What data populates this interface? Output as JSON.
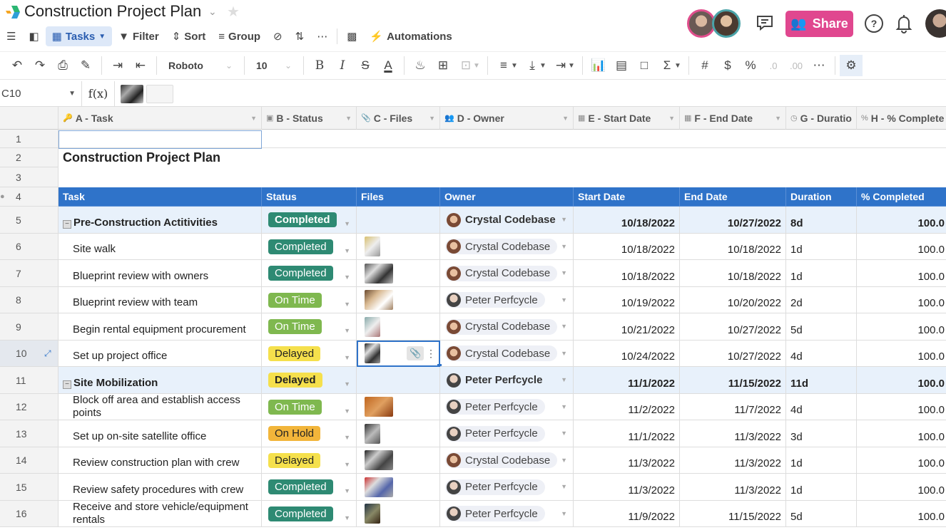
{
  "app": {
    "title": "Construction Project Plan",
    "share_label": "Share",
    "colors": {
      "accent": "#2f73c9",
      "share": "#e0478f",
      "completed": "#2e8a73",
      "on_time": "#7fb84f",
      "delayed": "#f5e04c",
      "on_hold": "#f2b53a"
    }
  },
  "viewbar": {
    "view_name": "Tasks",
    "filter": "Filter",
    "sort": "Sort",
    "group": "Group",
    "automations": "Automations"
  },
  "format": {
    "font": "Roboto",
    "size": "10"
  },
  "formula": {
    "cell_ref": "C10",
    "fx": "f(x)"
  },
  "columns": [
    {
      "label": "A - Task",
      "icon": "key-icon"
    },
    {
      "label": "B - Status",
      "icon": "dropdown-icon"
    },
    {
      "label": "C - Files",
      "icon": "attachment-icon"
    },
    {
      "label": "D - Owner",
      "icon": "people-icon"
    },
    {
      "label": "E - Start Date",
      "icon": "calendar-icon"
    },
    {
      "label": "F - End Date",
      "icon": "calendar-icon"
    },
    {
      "label": "G - Duratio",
      "icon": "clock-icon"
    },
    {
      "label": "H - % Complete",
      "icon": "percent-icon"
    }
  ],
  "sheet_title": "Construction Project Plan",
  "table_header": [
    "Task",
    "Status",
    "Files",
    "Owner",
    "Start Date",
    "End Date",
    "Duration",
    "% Completed"
  ],
  "rows": [
    {
      "num": "5",
      "group": true,
      "task": "Pre-Construction Actitivities",
      "status": "Completed",
      "status_key": "completed",
      "files": 0,
      "owner": "Crystal Codebase",
      "owner_key": "crystal",
      "start": "10/18/2022",
      "end": "10/27/2022",
      "duration": "8d",
      "pct": "100.0"
    },
    {
      "num": "6",
      "task": "Site walk",
      "status": "Completed",
      "status_key": "completed",
      "files": 1,
      "owner": "Crystal Codebase",
      "owner_key": "crystal",
      "start": "10/18/2022",
      "end": "10/18/2022",
      "duration": "1d",
      "pct": "100.0"
    },
    {
      "num": "7",
      "task": "Blueprint review with owners",
      "status": "Completed",
      "status_key": "completed",
      "files": 1,
      "owner": "Crystal Codebase",
      "owner_key": "crystal",
      "start": "10/18/2022",
      "end": "10/18/2022",
      "duration": "1d",
      "pct": "100.0"
    },
    {
      "num": "8",
      "task": "Blueprint review with team",
      "status": "On Time",
      "status_key": "ontime",
      "files": 1,
      "owner": "Peter Perfcycle",
      "owner_key": "peter",
      "start": "10/19/2022",
      "end": "10/20/2022",
      "duration": "2d",
      "pct": "100.0"
    },
    {
      "num": "9",
      "task": "Begin rental equipment procurement",
      "status": "On Time",
      "status_key": "ontime",
      "files": 1,
      "owner": "Crystal Codebase",
      "owner_key": "crystal",
      "start": "10/21/2022",
      "end": "10/27/2022",
      "duration": "5d",
      "pct": "100.0"
    },
    {
      "num": "10",
      "task": "Set up project office",
      "status": "Delayed",
      "status_key": "delayed",
      "files": 1,
      "owner": "Crystal Codebase",
      "owner_key": "crystal",
      "start": "10/24/2022",
      "end": "10/27/2022",
      "duration": "4d",
      "pct": "100.0",
      "selected_files": true
    },
    {
      "num": "11",
      "group": true,
      "task": "Site Mobilization",
      "status": "Delayed",
      "status_key": "delayed",
      "files": 0,
      "owner": "Peter Perfcycle",
      "owner_key": "peter",
      "start": "11/1/2022",
      "end": "11/15/2022",
      "duration": "11d",
      "pct": "100.0"
    },
    {
      "num": "12",
      "task": "Block off area and establish access points",
      "status": "On Time",
      "status_key": "ontime",
      "files": 1,
      "owner": "Peter Perfcycle",
      "owner_key": "peter",
      "start": "11/2/2022",
      "end": "11/7/2022",
      "duration": "4d",
      "pct": "100.0"
    },
    {
      "num": "13",
      "task": "Set up on-site satellite office",
      "status": "On Hold",
      "status_key": "onhold",
      "files": 1,
      "owner": "Peter Perfcycle",
      "owner_key": "peter",
      "start": "11/1/2022",
      "end": "11/3/2022",
      "duration": "3d",
      "pct": "100.0"
    },
    {
      "num": "14",
      "task": "Review construction plan with crew",
      "status": "Delayed",
      "status_key": "delayed",
      "files": 1,
      "owner": "Crystal Codebase",
      "owner_key": "crystal",
      "start": "11/3/2022",
      "end": "11/3/2022",
      "duration": "1d",
      "pct": "100.0"
    },
    {
      "num": "15",
      "task": "Review safety procedures with crew",
      "status": "Completed",
      "status_key": "completed",
      "files": 1,
      "owner": "Peter Perfcycle",
      "owner_key": "peter",
      "start": "11/3/2022",
      "end": "11/3/2022",
      "duration": "1d",
      "pct": "100.0"
    },
    {
      "num": "16",
      "task": "Receive and store vehicle/equipment rentals",
      "status": "Completed",
      "status_key": "completed",
      "files": 1,
      "owner": "Peter Perfcycle",
      "owner_key": "peter",
      "start": "11/9/2022",
      "end": "11/15/2022",
      "duration": "5d",
      "pct": "100.0"
    }
  ]
}
